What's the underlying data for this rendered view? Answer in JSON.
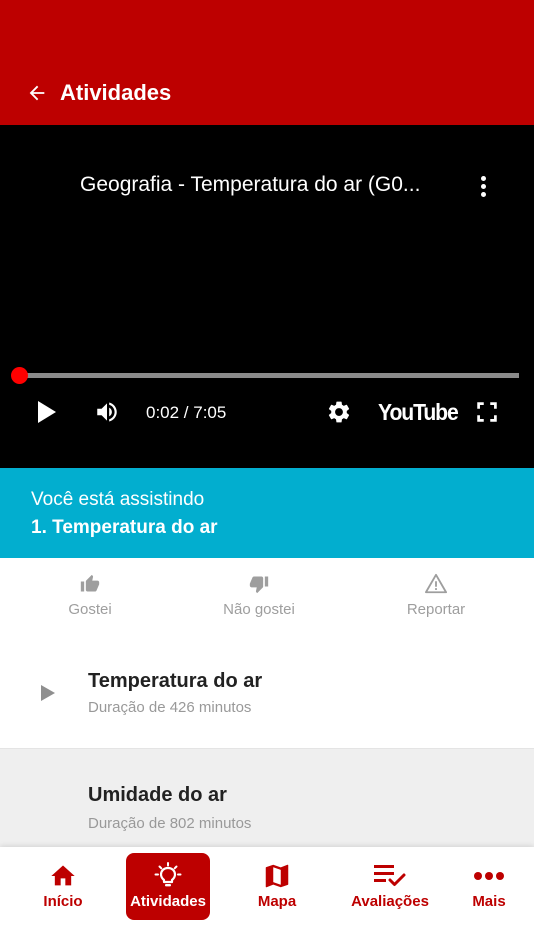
{
  "header": {
    "title": "Atividades"
  },
  "video": {
    "title": "Geografia - Temperatura do ar (G0...",
    "time": "0:02 / 7:05",
    "progress_fraction": 0.004,
    "brand": "YouTube"
  },
  "now_watching": {
    "label": "Você está assistindo",
    "title": "1. Temperatura do ar"
  },
  "reactions": [
    {
      "label": "Gostei",
      "icon": "thumbs-up-icon"
    },
    {
      "label": "Não gostei",
      "icon": "thumbs-down-icon"
    },
    {
      "label": "Reportar",
      "icon": "warning-icon"
    }
  ],
  "lessons": [
    {
      "title": "Temperatura do ar",
      "subtitle": "Duração de 426 minutos"
    },
    {
      "title": "Umidade do ar",
      "subtitle": "Duração de 802 minutos"
    }
  ],
  "nav": [
    {
      "label": "Início",
      "icon": "home-icon",
      "active": false
    },
    {
      "label": "Atividades",
      "icon": "lightbulb-icon",
      "active": true
    },
    {
      "label": "Mapa",
      "icon": "map-icon",
      "active": false
    },
    {
      "label": "Avaliações",
      "icon": "checklist-icon",
      "active": false
    },
    {
      "label": "Mais",
      "icon": "more-dots-icon",
      "active": false
    }
  ],
  "colors": {
    "primary": "#bd0000",
    "accent": "#02aecf",
    "player_progress": "#ff0000"
  }
}
